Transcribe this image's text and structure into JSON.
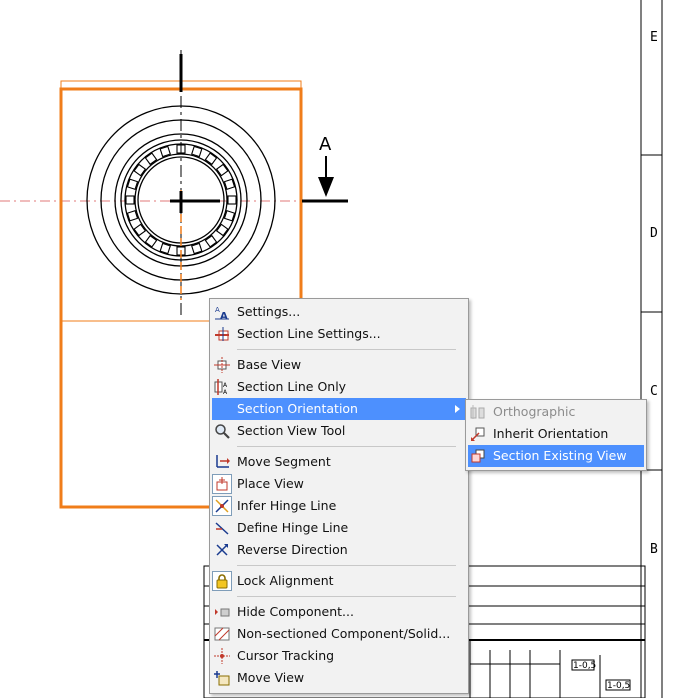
{
  "drawing": {
    "section_label": "A",
    "frame_letters": [
      "E",
      "D",
      "C",
      "B"
    ],
    "table_values": [
      "1-0,5",
      "1-0,5"
    ]
  },
  "context_menu": {
    "items": [
      {
        "label": "Settings...",
        "icon": "settings-icon"
      },
      {
        "label": "Section Line Settings...",
        "icon": "section-line-settings-icon"
      },
      {
        "label": "Base View",
        "icon": "base-view-icon"
      },
      {
        "label": "Section Line Only",
        "icon": "section-line-only-icon"
      },
      {
        "label": "Section Orientation",
        "icon": "none",
        "highlighted": true,
        "submenu": true
      },
      {
        "label": "Section View Tool",
        "icon": "magnifier-icon"
      },
      {
        "label": "Move Segment",
        "icon": "move-segment-icon"
      },
      {
        "label": "Place View",
        "icon": "place-view-icon"
      },
      {
        "label": "Infer Hinge Line",
        "icon": "infer-hinge-line-icon"
      },
      {
        "label": "Define Hinge Line",
        "icon": "define-hinge-line-icon"
      },
      {
        "label": "Reverse Direction",
        "icon": "reverse-direction-icon"
      },
      {
        "label": "Lock Alignment",
        "icon": "lock-icon"
      },
      {
        "label": "Hide Component...",
        "icon": "hide-component-icon"
      },
      {
        "label": "Non-sectioned Component/Solid...",
        "icon": "non-sectioned-component-icon"
      },
      {
        "label": "Cursor Tracking",
        "icon": "cursor-tracking-icon"
      },
      {
        "label": "Move View",
        "icon": "move-view-icon"
      }
    ]
  },
  "submenu": {
    "items": [
      {
        "label": "Orthographic",
        "disabled": true,
        "icon": "orthographic-icon"
      },
      {
        "label": "Inherit Orientation",
        "icon": "inherit-orientation-icon"
      },
      {
        "label": "Section Existing View",
        "highlighted": true,
        "icon": "section-existing-view-icon"
      }
    ]
  },
  "colors": {
    "menu_bg": "#f2f2f2",
    "highlight": "#4d90fe",
    "view_border": "#f07d1a",
    "centerline": "#e07a7a"
  }
}
